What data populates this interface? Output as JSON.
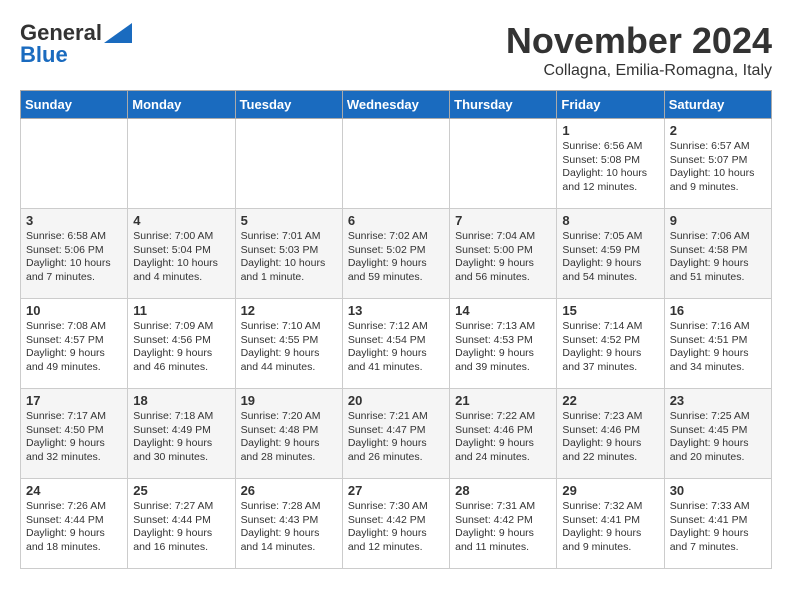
{
  "header": {
    "logo_general": "General",
    "logo_blue": "Blue",
    "month": "November 2024",
    "location": "Collagna, Emilia-Romagna, Italy"
  },
  "days_of_week": [
    "Sunday",
    "Monday",
    "Tuesday",
    "Wednesday",
    "Thursday",
    "Friday",
    "Saturday"
  ],
  "weeks": [
    [
      {
        "day": "",
        "info": ""
      },
      {
        "day": "",
        "info": ""
      },
      {
        "day": "",
        "info": ""
      },
      {
        "day": "",
        "info": ""
      },
      {
        "day": "",
        "info": ""
      },
      {
        "day": "1",
        "info": "Sunrise: 6:56 AM\nSunset: 5:08 PM\nDaylight: 10 hours and 12 minutes."
      },
      {
        "day": "2",
        "info": "Sunrise: 6:57 AM\nSunset: 5:07 PM\nDaylight: 10 hours and 9 minutes."
      }
    ],
    [
      {
        "day": "3",
        "info": "Sunrise: 6:58 AM\nSunset: 5:06 PM\nDaylight: 10 hours and 7 minutes."
      },
      {
        "day": "4",
        "info": "Sunrise: 7:00 AM\nSunset: 5:04 PM\nDaylight: 10 hours and 4 minutes."
      },
      {
        "day": "5",
        "info": "Sunrise: 7:01 AM\nSunset: 5:03 PM\nDaylight: 10 hours and 1 minute."
      },
      {
        "day": "6",
        "info": "Sunrise: 7:02 AM\nSunset: 5:02 PM\nDaylight: 9 hours and 59 minutes."
      },
      {
        "day": "7",
        "info": "Sunrise: 7:04 AM\nSunset: 5:00 PM\nDaylight: 9 hours and 56 minutes."
      },
      {
        "day": "8",
        "info": "Sunrise: 7:05 AM\nSunset: 4:59 PM\nDaylight: 9 hours and 54 minutes."
      },
      {
        "day": "9",
        "info": "Sunrise: 7:06 AM\nSunset: 4:58 PM\nDaylight: 9 hours and 51 minutes."
      }
    ],
    [
      {
        "day": "10",
        "info": "Sunrise: 7:08 AM\nSunset: 4:57 PM\nDaylight: 9 hours and 49 minutes."
      },
      {
        "day": "11",
        "info": "Sunrise: 7:09 AM\nSunset: 4:56 PM\nDaylight: 9 hours and 46 minutes."
      },
      {
        "day": "12",
        "info": "Sunrise: 7:10 AM\nSunset: 4:55 PM\nDaylight: 9 hours and 44 minutes."
      },
      {
        "day": "13",
        "info": "Sunrise: 7:12 AM\nSunset: 4:54 PM\nDaylight: 9 hours and 41 minutes."
      },
      {
        "day": "14",
        "info": "Sunrise: 7:13 AM\nSunset: 4:53 PM\nDaylight: 9 hours and 39 minutes."
      },
      {
        "day": "15",
        "info": "Sunrise: 7:14 AM\nSunset: 4:52 PM\nDaylight: 9 hours and 37 minutes."
      },
      {
        "day": "16",
        "info": "Sunrise: 7:16 AM\nSunset: 4:51 PM\nDaylight: 9 hours and 34 minutes."
      }
    ],
    [
      {
        "day": "17",
        "info": "Sunrise: 7:17 AM\nSunset: 4:50 PM\nDaylight: 9 hours and 32 minutes."
      },
      {
        "day": "18",
        "info": "Sunrise: 7:18 AM\nSunset: 4:49 PM\nDaylight: 9 hours and 30 minutes."
      },
      {
        "day": "19",
        "info": "Sunrise: 7:20 AM\nSunset: 4:48 PM\nDaylight: 9 hours and 28 minutes."
      },
      {
        "day": "20",
        "info": "Sunrise: 7:21 AM\nSunset: 4:47 PM\nDaylight: 9 hours and 26 minutes."
      },
      {
        "day": "21",
        "info": "Sunrise: 7:22 AM\nSunset: 4:46 PM\nDaylight: 9 hours and 24 minutes."
      },
      {
        "day": "22",
        "info": "Sunrise: 7:23 AM\nSunset: 4:46 PM\nDaylight: 9 hours and 22 minutes."
      },
      {
        "day": "23",
        "info": "Sunrise: 7:25 AM\nSunset: 4:45 PM\nDaylight: 9 hours and 20 minutes."
      }
    ],
    [
      {
        "day": "24",
        "info": "Sunrise: 7:26 AM\nSunset: 4:44 PM\nDaylight: 9 hours and 18 minutes."
      },
      {
        "day": "25",
        "info": "Sunrise: 7:27 AM\nSunset: 4:44 PM\nDaylight: 9 hours and 16 minutes."
      },
      {
        "day": "26",
        "info": "Sunrise: 7:28 AM\nSunset: 4:43 PM\nDaylight: 9 hours and 14 minutes."
      },
      {
        "day": "27",
        "info": "Sunrise: 7:30 AM\nSunset: 4:42 PM\nDaylight: 9 hours and 12 minutes."
      },
      {
        "day": "28",
        "info": "Sunrise: 7:31 AM\nSunset: 4:42 PM\nDaylight: 9 hours and 11 minutes."
      },
      {
        "day": "29",
        "info": "Sunrise: 7:32 AM\nSunset: 4:41 PM\nDaylight: 9 hours and 9 minutes."
      },
      {
        "day": "30",
        "info": "Sunrise: 7:33 AM\nSunset: 4:41 PM\nDaylight: 9 hours and 7 minutes."
      }
    ]
  ]
}
